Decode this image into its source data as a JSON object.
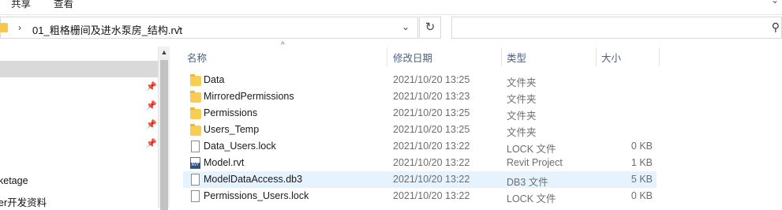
{
  "ribbon": {
    "tabs": [
      "共享",
      "查看"
    ],
    "expand_icon": "chevron-down-icon"
  },
  "address_bar": {
    "separator": "›",
    "path_crumb": "01_粗格栅间及进水泵房_结构.rvt",
    "dropdown_icon": "chevron-down-icon",
    "refresh_icon": "refresh-icon"
  },
  "search": {
    "placeholder": "",
    "icon": "search-icon"
  },
  "nav_pane": {
    "items": [
      "ketage",
      "er开发资料"
    ],
    "pin_icon": "pin-icon"
  },
  "columns": {
    "name": "名称",
    "date": "修改日期",
    "type": "类型",
    "size": "大小",
    "sort_icon": "sort-ascending-icon"
  },
  "files": [
    {
      "name": "Data",
      "date": "2021/10/20 13:25",
      "type": "文件夹",
      "size": "",
      "icon": "folder-icon"
    },
    {
      "name": "MirroredPermissions",
      "date": "2021/10/20 13:23",
      "type": "文件夹",
      "size": "",
      "icon": "folder-icon"
    },
    {
      "name": "Permissions",
      "date": "2021/10/20 13:25",
      "type": "文件夹",
      "size": "",
      "icon": "folder-icon"
    },
    {
      "name": "Users_Temp",
      "date": "2021/10/20 13:25",
      "type": "文件夹",
      "size": "",
      "icon": "folder-icon"
    },
    {
      "name": "Data_Users.lock",
      "date": "2021/10/20 13:22",
      "type": "LOCK 文件",
      "size": "0 KB",
      "icon": "file-icon"
    },
    {
      "name": "Model.rvt",
      "date": "2021/10/20 13:22",
      "type": "Revit Project",
      "size": "1 KB",
      "icon": "revit-file-icon",
      "icon_label": "RVT"
    },
    {
      "name": "ModelDataAccess.db3",
      "date": "2021/10/20 13:22",
      "type": "DB3 文件",
      "size": "5 KB",
      "icon": "file-icon",
      "highlighted": true
    },
    {
      "name": "Permissions_Users.lock",
      "date": "2021/10/20 13:22",
      "type": "LOCK 文件",
      "size": "0 KB",
      "icon": "file-icon"
    }
  ],
  "colors": {
    "folder": "#f7cd55",
    "row_highlight": "#e5f3ff",
    "header_text": "#4c607a",
    "nav_selection": "#d9d9d9"
  }
}
